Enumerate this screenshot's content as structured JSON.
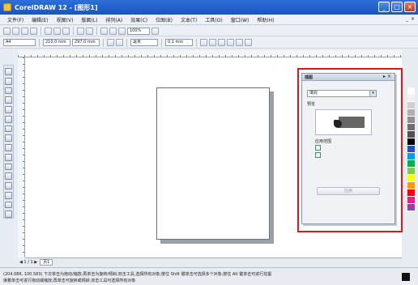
{
  "titlebar": {
    "title": "CorelDRAW 12 - [图形1]",
    "buttons": [
      "_",
      "□",
      "×"
    ]
  },
  "menubar": {
    "items": [
      "文件(F)",
      "编辑(E)",
      "视图(V)",
      "版面(L)",
      "排列(A)",
      "效果(C)",
      "位图(B)",
      "文本(T)",
      "工具(O)",
      "窗口(W)",
      "帮助(H)"
    ],
    "sys_buttons": [
      "_",
      "×"
    ]
  },
  "toolbar1": {
    "zoom_value": "100%"
  },
  "toolbar2": {
    "paper_value": "A4",
    "width_value": "210.0 mm",
    "height_value": "297.0 mm",
    "units_value": "毫米",
    "nudge_value": "0.1 mm"
  },
  "docker": {
    "title": "插图",
    "dropdown_value": "填充",
    "preview_label": "预览",
    "option_label": "应用范围",
    "apply_label": "应用"
  },
  "pagetabs": {
    "nav": "◀ 1 / 1 ▶",
    "tab_label": "页1"
  },
  "statusbar": {
    "line1": "(204.086, 100.583)   下次单击为拖动/缩放;再单击为旋转/倾斜;双击工具,选择所有对象;按住 Shift 键单击可选择多个对象;按住 Alt 键单击可进行挖掘",
    "line2": "接着单击可进行拖动或缩放;再单击可旋转或倾斜;双击工具可选择所有对象"
  },
  "colors": {
    "accent": "#1c55c2",
    "highlight": "#e0161b",
    "palette": [
      "#ffffff",
      "#f0f0f0",
      "#d0d0d0",
      "#b0b0b0",
      "#909090",
      "#707070",
      "#505050",
      "#000000",
      "#1e4fd8",
      "#00a0e9",
      "#00b050",
      "#7fd13b",
      "#ffff00",
      "#ff9900",
      "#ff0000",
      "#e91e8c",
      "#8e44ad"
    ]
  }
}
